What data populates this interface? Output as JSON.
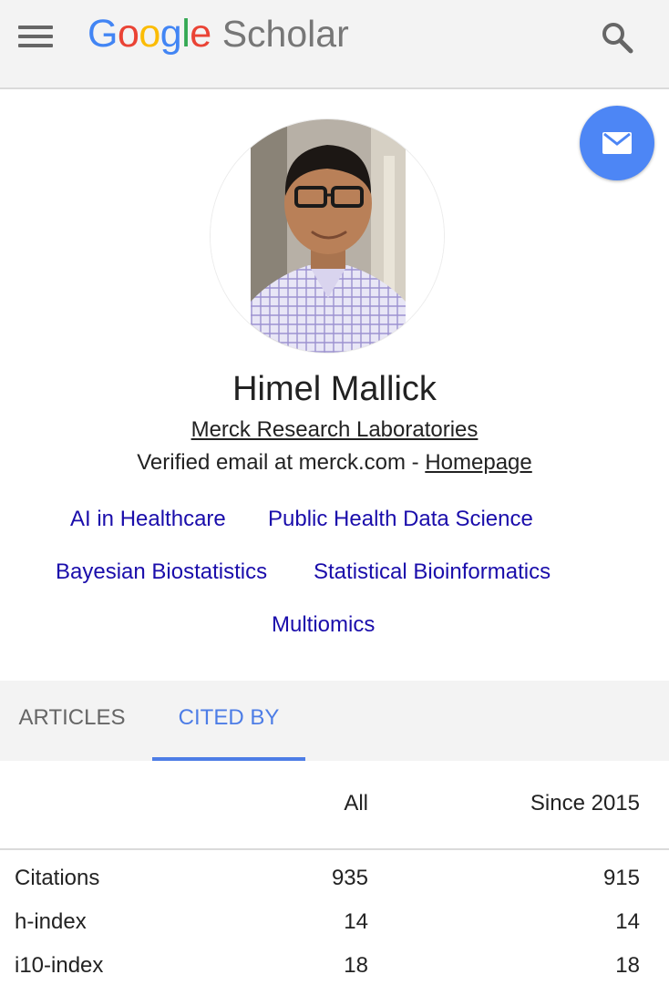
{
  "header": {
    "logo": [
      "G",
      "o",
      "o",
      "g",
      "l",
      "e"
    ],
    "product": "Scholar"
  },
  "profile": {
    "name": "Himel Mallick",
    "affiliation": "Merck Research Laboratories",
    "email_text": "Verified email at merck.com - ",
    "homepage_label": "Homepage",
    "interests": [
      "AI in Healthcare",
      "Public Health Data Science",
      "Bayesian Biostatistics",
      "Statistical Bioinformatics",
      "Multiomics"
    ]
  },
  "tabs": [
    {
      "label": "ARTICLES",
      "active": false
    },
    {
      "label": "CITED BY",
      "active": true
    }
  ],
  "metrics": {
    "headers": [
      "All",
      "Since 2015"
    ],
    "rows": [
      {
        "label": "Citations",
        "all": "935",
        "since": "915"
      },
      {
        "label": "h-index",
        "all": "14",
        "since": "14"
      },
      {
        "label": "i10-index",
        "all": "18",
        "since": "18"
      }
    ]
  },
  "colors": {
    "link": "#1a0dab",
    "accent": "#4d7de6",
    "fab": "#4d86f5"
  },
  "icons": {
    "menu": "menu-icon",
    "search": "search-icon",
    "email": "mail-icon"
  }
}
